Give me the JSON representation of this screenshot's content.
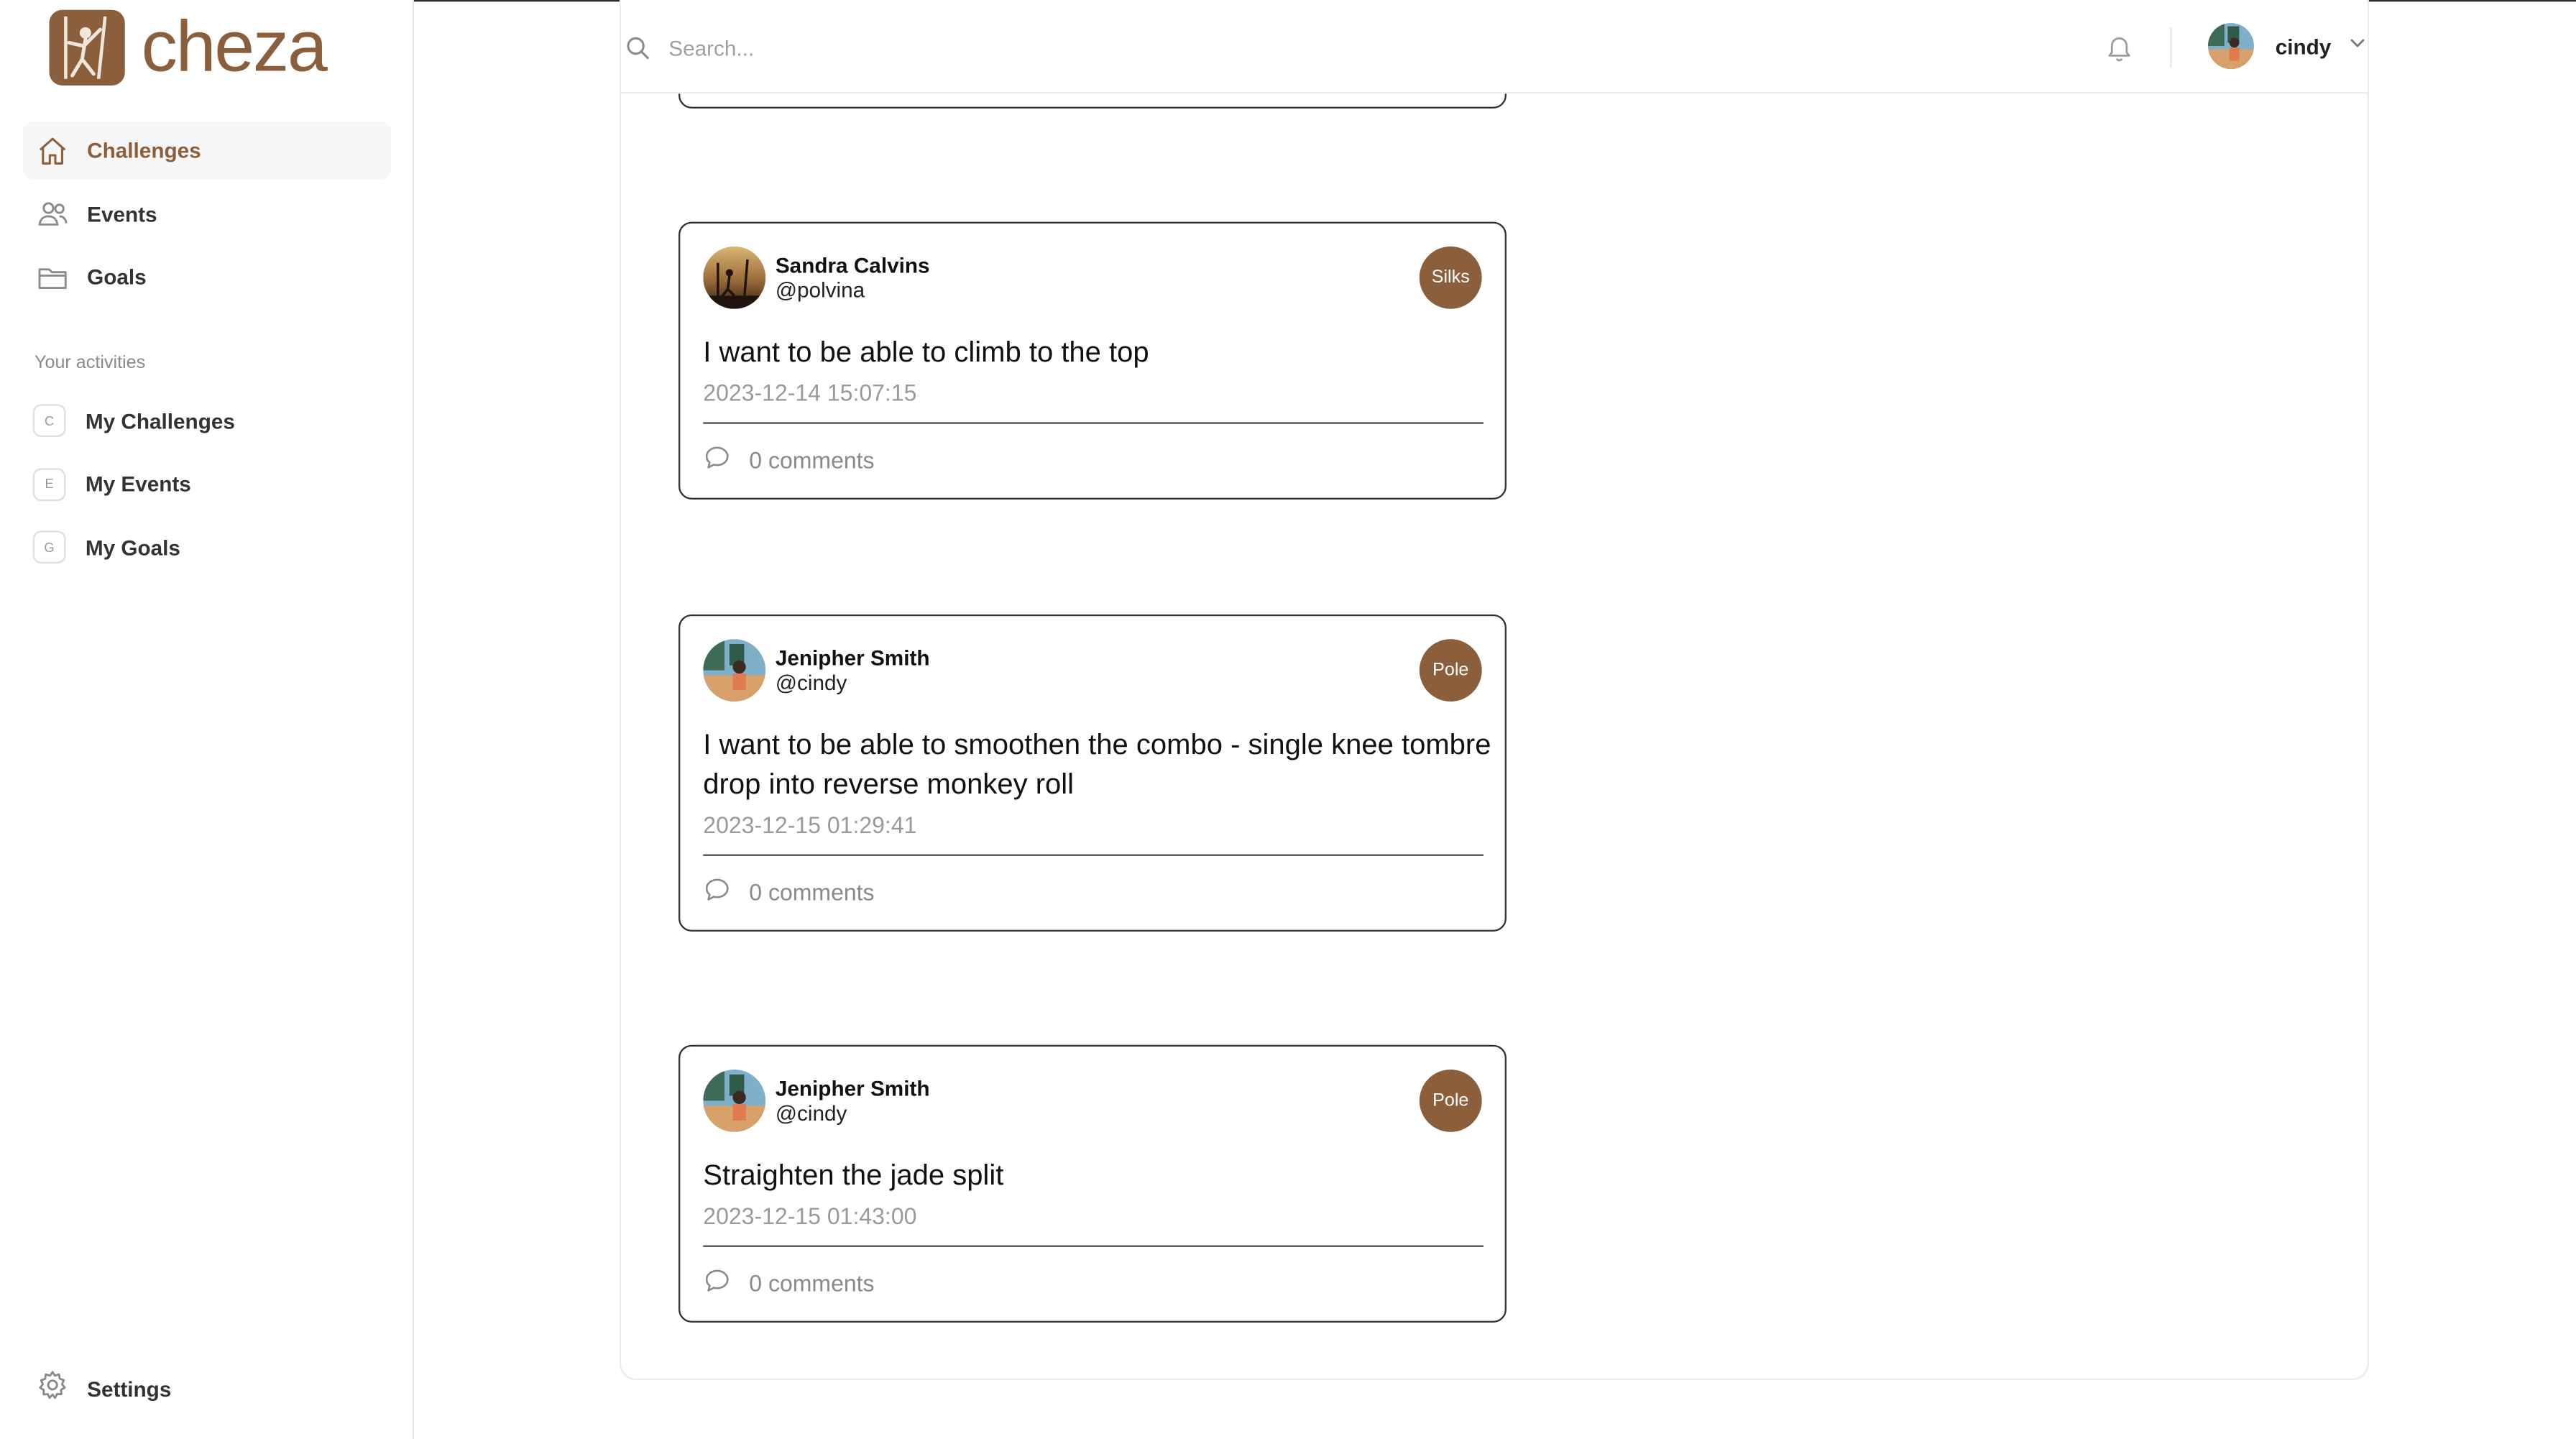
{
  "brand": {
    "name": "cheza",
    "color": "#8b5e3c"
  },
  "sidebar": {
    "nav": [
      {
        "label": "Challenges",
        "icon": "home-icon",
        "active": true
      },
      {
        "label": "Events",
        "icon": "users-icon",
        "active": false
      },
      {
        "label": "Goals",
        "icon": "folder-icon",
        "active": false
      }
    ],
    "section_label": "Your activities",
    "activities": [
      {
        "badge": "C",
        "label": "My Challenges"
      },
      {
        "badge": "E",
        "label": "My Events"
      },
      {
        "badge": "G",
        "label": "My Goals"
      }
    ],
    "settings_label": "Settings"
  },
  "header": {
    "search_placeholder": "Search...",
    "user_name": "cindy"
  },
  "feed": [
    {
      "name": "Sandra Calvins",
      "handle": "@polvina",
      "tag": "Silks",
      "text": "I want to be able to climb to the top",
      "timestamp": "2023-12-14 15:07:15",
      "comments": "0 comments"
    },
    {
      "name": "Jenipher Smith",
      "handle": "@cindy",
      "tag": "Pole",
      "text": "I want to be able to smoothen the combo - single knee tombre drop into reverse monkey roll",
      "timestamp": "2023-12-15 01:29:41",
      "comments": "0 comments"
    },
    {
      "name": "Jenipher Smith",
      "handle": "@cindy",
      "tag": "Pole",
      "text": "Straighten the jade split",
      "timestamp": "2023-12-15 01:43:00",
      "comments": "0 comments"
    }
  ]
}
